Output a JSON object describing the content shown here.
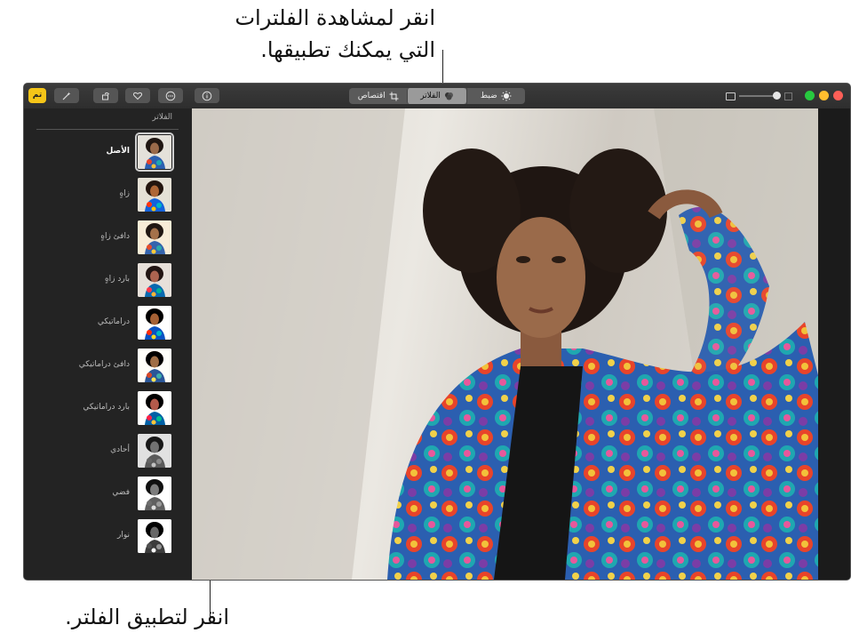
{
  "callouts": {
    "top_line1": "انقر لمشاهدة الفلترات",
    "top_line2": "التي يمكنك تطبيقها.",
    "bottom": "انقر لتطبيق الفلتر."
  },
  "toolbar": {
    "done_label": "تم",
    "tabs": [
      {
        "label": "ضبط",
        "icon": "adjust-icon"
      },
      {
        "label": "الفلاتر",
        "icon": "filters-icon",
        "active": true
      },
      {
        "label": "اقتصاص",
        "icon": "crop-icon"
      }
    ],
    "icons": [
      "magic-wand-icon",
      "rotate-icon",
      "heart-icon",
      "more-icon",
      "info-icon"
    ]
  },
  "sidebar": {
    "title": "الفلاتر",
    "filters": [
      {
        "label": "الأصل",
        "tone": "color",
        "selected": true
      },
      {
        "label": "زاهٍ",
        "tone": "vivid"
      },
      {
        "label": "دافئ زاهٍ",
        "tone": "warm"
      },
      {
        "label": "بارد زاهٍ",
        "tone": "cool"
      },
      {
        "label": "دراماتيكي",
        "tone": "dramatic"
      },
      {
        "label": "دافئ دراماتيكي",
        "tone": "warm-dramatic"
      },
      {
        "label": "بارد دراماتيكي",
        "tone": "cool-dramatic"
      },
      {
        "label": "أحادي",
        "tone": "mono"
      },
      {
        "label": "فضي",
        "tone": "silver"
      },
      {
        "label": "نوار",
        "tone": "noir"
      }
    ]
  },
  "colors": {
    "accent_done": "#f5c518",
    "light_red": "#ff5f57",
    "light_yellow": "#ffbd2e",
    "light_green": "#27c93f"
  }
}
